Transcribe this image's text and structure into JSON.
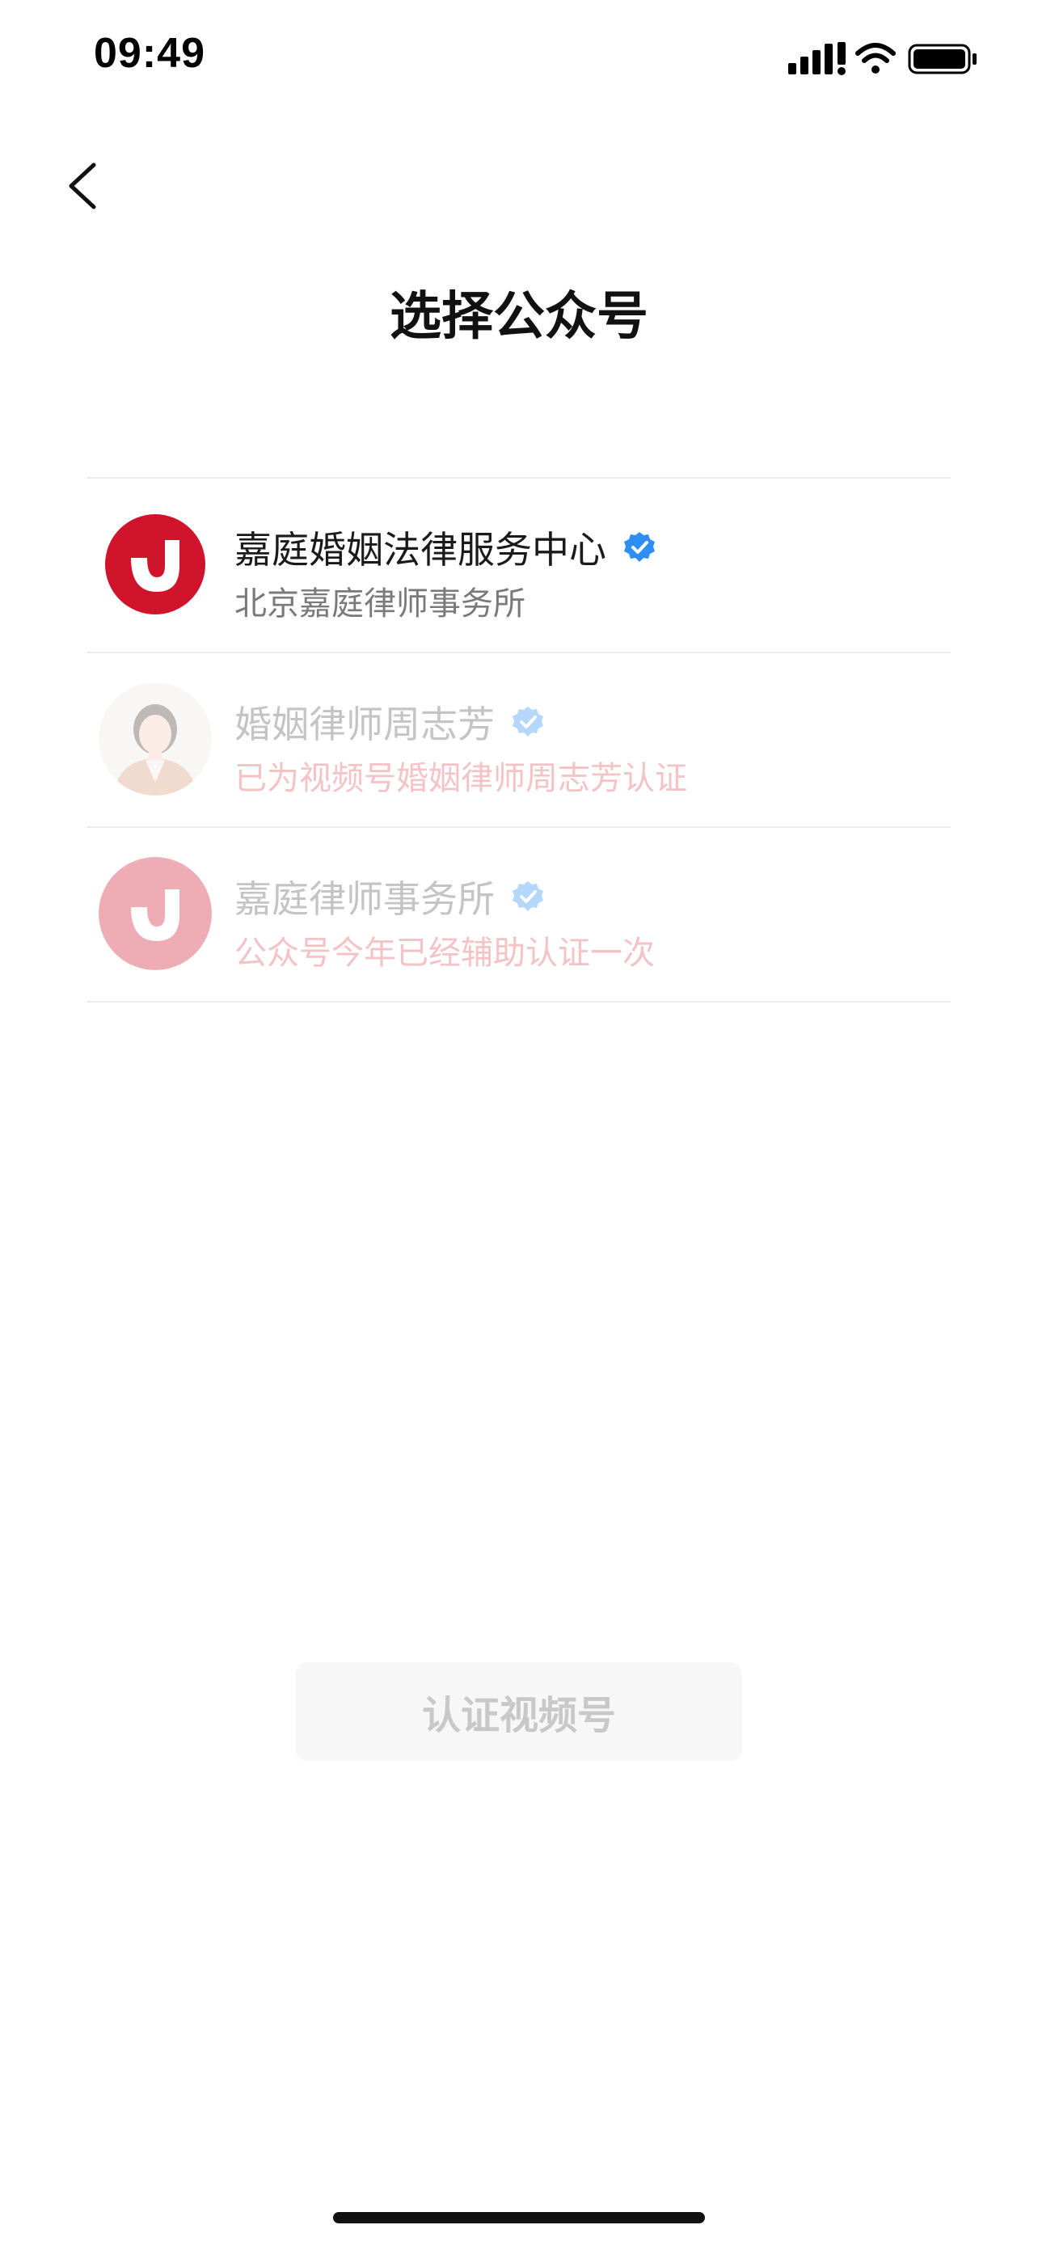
{
  "status_bar": {
    "time": "09:49"
  },
  "page": {
    "title": "选择公众号"
  },
  "accounts": [
    {
      "name": "嘉庭婚姻法律服务中心",
      "subtitle": "北京嘉庭律师事务所",
      "verified": true,
      "enabled": true,
      "avatar_icon": "jiating-logo-icon"
    },
    {
      "name": "婚姻律师周志芳",
      "subtitle": "已为视频号婚姻律师周志芳认证",
      "verified": true,
      "enabled": false,
      "avatar_icon": "person-photo-avatar"
    },
    {
      "name": "嘉庭律师事务所",
      "subtitle": "公众号今年已经辅助认证一次",
      "verified": true,
      "enabled": false,
      "avatar_icon": "jiating-logo-icon"
    }
  ],
  "actions": {
    "confirm_label": "认证视频号",
    "confirm_enabled": false
  },
  "colors": {
    "brand_red": "#d0142c",
    "verified_blue": "#2e8ef5",
    "disabled_text": "#c4c4c4",
    "disabled_subtitle": "#f3c3c6",
    "button_bg": "#f7f7f7"
  }
}
